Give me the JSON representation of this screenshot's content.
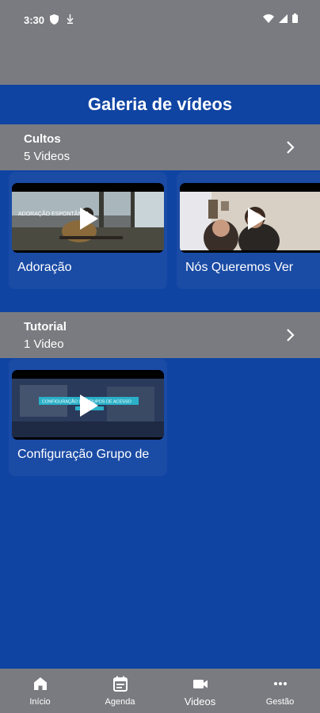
{
  "status_bar": {
    "time": "3:30"
  },
  "header": {
    "title": "Galeria de vídeos"
  },
  "sections": [
    {
      "title": "Cultos",
      "count": "5 Videos",
      "videos": [
        {
          "title": "Adoração",
          "thumb_text": "ADORAÇÃO ESPONTÂNEA"
        },
        {
          "title": "Nós Queremos Ver"
        }
      ]
    },
    {
      "title": "Tutorial",
      "count": "1 Video",
      "videos": [
        {
          "title": "Configuração Grupo de",
          "thumb_text": "CONFIGURAÇÃO DE GRUPOS DE ACESSO"
        }
      ]
    }
  ],
  "bottom_nav": [
    {
      "label": "Início",
      "icon": "home-icon"
    },
    {
      "label": "Agenda",
      "icon": "calendar-icon"
    },
    {
      "label": "Videos",
      "icon": "video-camera-icon",
      "active": true
    },
    {
      "label": "Gestão",
      "icon": "more-icon"
    }
  ],
  "colors": {
    "primary": "#0f44a3",
    "gray_bar": "#7a7b80",
    "card": "#1a4ba5"
  }
}
